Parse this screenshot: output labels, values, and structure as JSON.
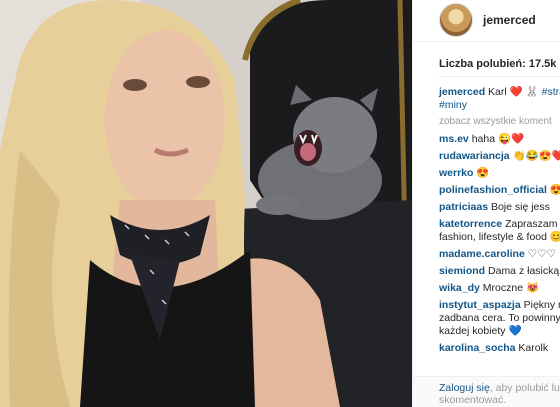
{
  "post": {
    "username": "jemerced",
    "likes_text": "Liczba polubień: 17.5k"
  },
  "caption": {
    "username": "jemerced",
    "text": "Karl ❤️ 🐰",
    "tags": "#stra",
    "tags2": "#miny"
  },
  "view_all": "zobacz wszystkie koment",
  "comments": [
    {
      "user": "ms.ev",
      "text": "haha 😜❤️"
    },
    {
      "user": "rudawariancja",
      "text": "👏😂😍❤️"
    },
    {
      "user": "werrko",
      "text": "😍"
    },
    {
      "user": "polinefashion_official",
      "text": "😍"
    },
    {
      "user": "patriciaas",
      "text": "Boje się jess"
    },
    {
      "user": "katetorrence",
      "text": "Zapraszam",
      "text2": "fashion, lifestyle & food 😊"
    },
    {
      "user": "madame.caroline",
      "text": "♡♡♡"
    },
    {
      "user": "siemiond",
      "text": "Dama z łasicką"
    },
    {
      "user": "wika_dy",
      "text": "Mroczne 😻"
    },
    {
      "user": "instytut_aspazja",
      "text": "Piękny m",
      "text2": "zadbana cera. To powinny",
      "text3": "każdej kobiety 💙"
    },
    {
      "user": "karolina_socha",
      "text": "Karolk"
    }
  ],
  "login": {
    "link": "Zaloguj się",
    "text": ", aby polubić lu",
    "text2": "skomentować."
  }
}
